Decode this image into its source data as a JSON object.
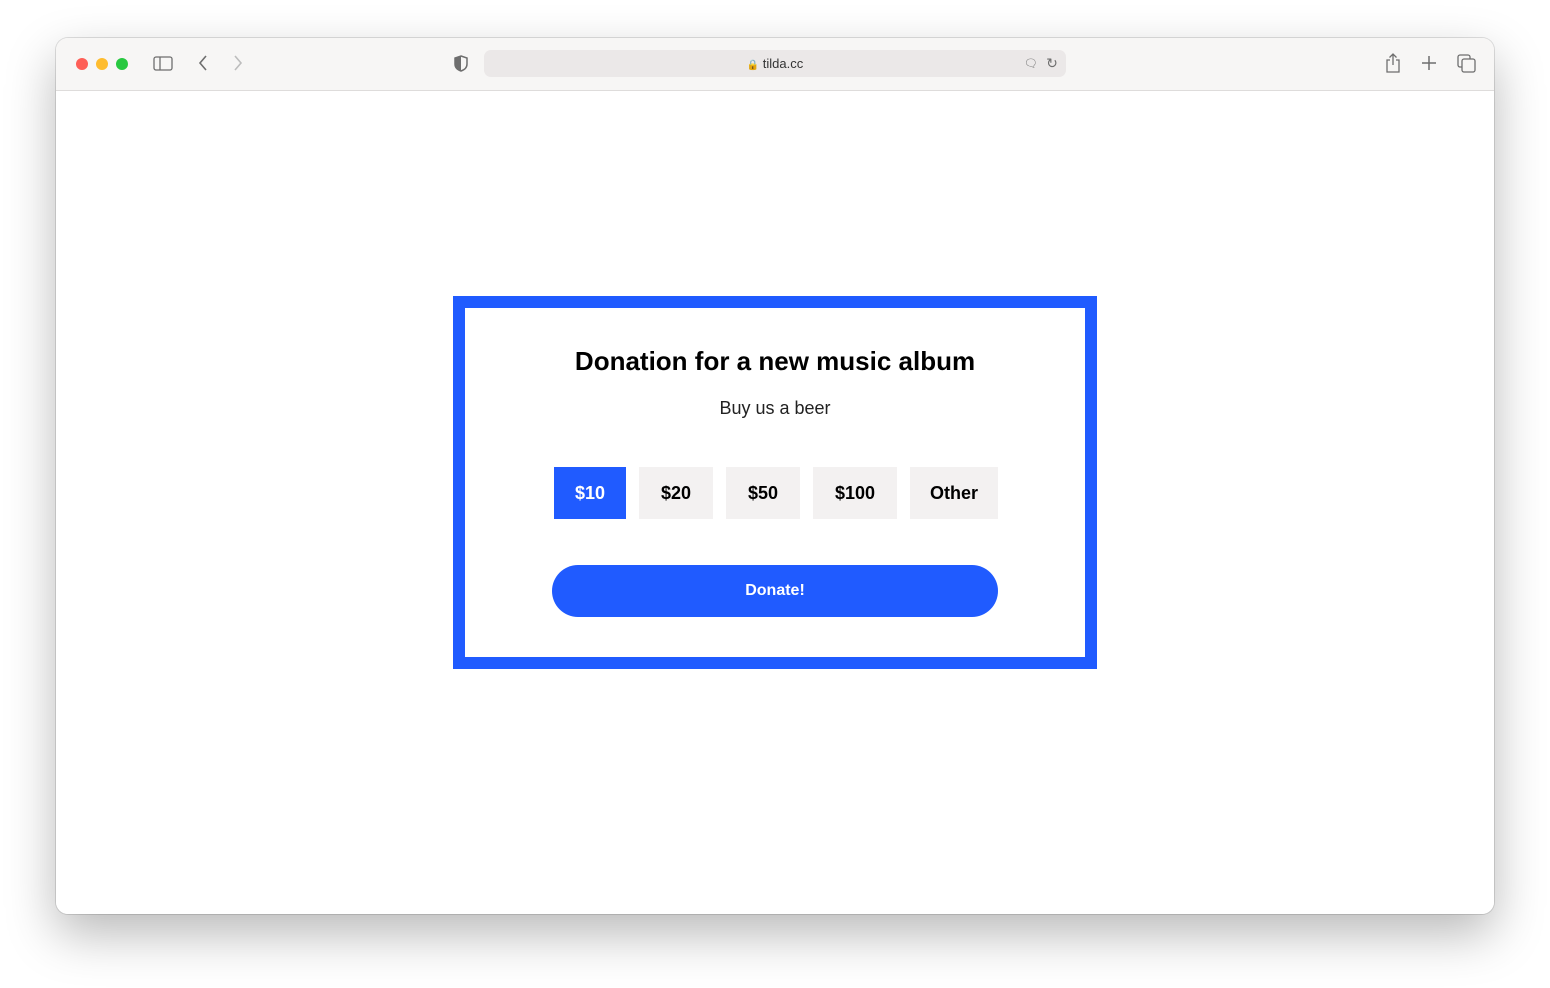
{
  "browser": {
    "url": "tilda.cc"
  },
  "donation": {
    "title": "Donation for a new music album",
    "subtitle": "Buy us a beer",
    "amounts": [
      {
        "label": "$10",
        "selected": true
      },
      {
        "label": "$20",
        "selected": false
      },
      {
        "label": "$50",
        "selected": false
      },
      {
        "label": "$100",
        "selected": false
      },
      {
        "label": "Other",
        "selected": false
      }
    ],
    "donate_label": "Donate!",
    "accent_color": "#205bff"
  }
}
